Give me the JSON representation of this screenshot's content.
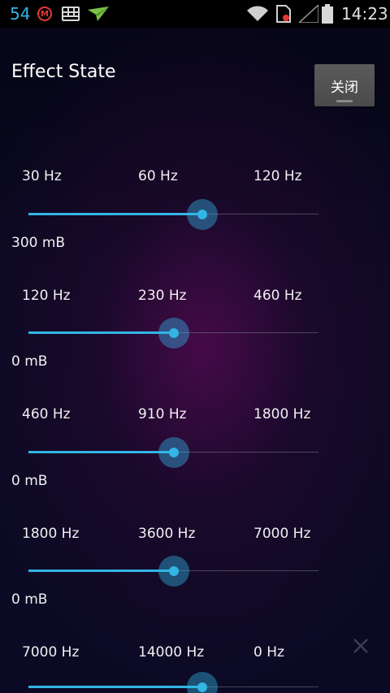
{
  "status_bar": {
    "notification_count": "54",
    "time": "14:23",
    "icons": [
      "m-circle-icon",
      "grid-icon",
      "paper-plane-icon",
      "wifi-icon",
      "sim-card-icon",
      "signal-icon",
      "battery-icon"
    ]
  },
  "title": "Effect State",
  "close_button_label": "关闭",
  "accent_color": "#33b5e5",
  "bands": [
    {
      "freqs": [
        "30 Hz",
        "60 Hz",
        "120 Hz"
      ],
      "level": "300 mB",
      "slider_position": 0.6
    },
    {
      "freqs": [
        "120 Hz",
        "230 Hz",
        "460 Hz"
      ],
      "level": "0 mB",
      "slider_position": 0.5
    },
    {
      "freqs": [
        "460 Hz",
        "910 Hz",
        "1800 Hz"
      ],
      "level": "0 mB",
      "slider_position": 0.5
    },
    {
      "freqs": [
        "1800 Hz",
        "3600 Hz",
        "7000 Hz"
      ],
      "level": "0 mB",
      "slider_position": 0.5
    },
    {
      "freqs": [
        "7000 Hz",
        "14000 Hz",
        "0 Hz"
      ],
      "level": "",
      "slider_position": 0.6
    }
  ]
}
